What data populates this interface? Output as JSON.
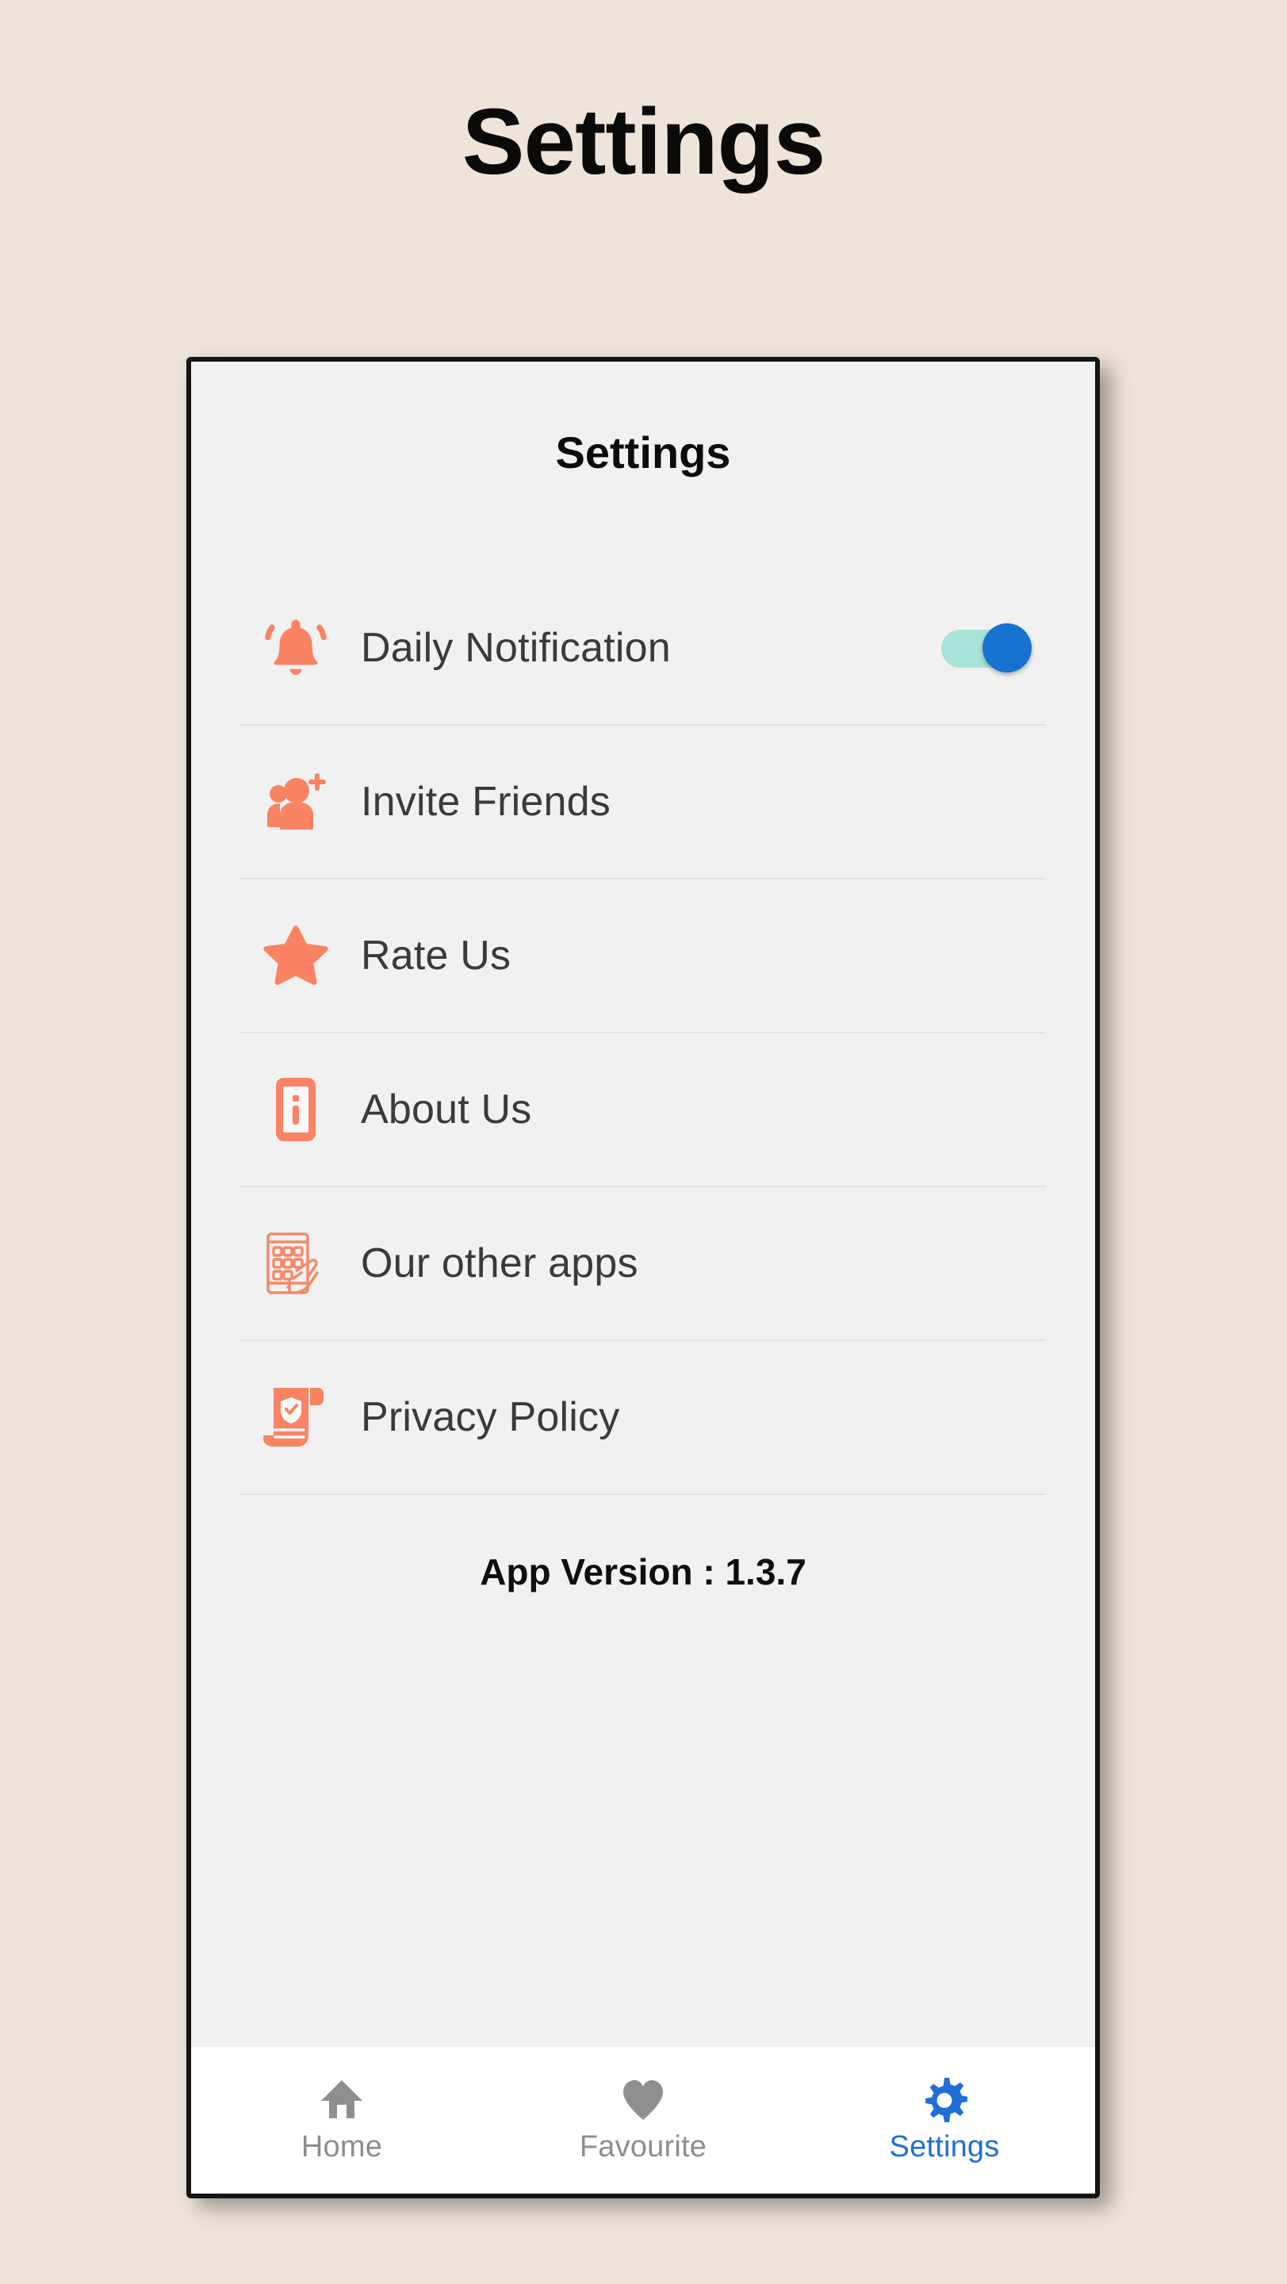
{
  "page": {
    "title": "Settings",
    "background_color": "#efe4d9"
  },
  "phone": {
    "screen_header": "Settings",
    "screen_background": "#f1f1f1",
    "accent_color": "#f98363",
    "toggle_on_track_color": "#a8e3da",
    "toggle_on_thumb_color": "#1773cf",
    "active_nav_color": "#1f6fd6",
    "inactive_nav_color": "#8e8e8e"
  },
  "settings": {
    "rows": [
      {
        "label": "Daily Notification",
        "icon": "bell-icon",
        "control": "toggle",
        "toggle_state": "on"
      },
      {
        "label": "Invite Friends",
        "icon": "invite-friends-icon",
        "control": "none"
      },
      {
        "label": "Rate Us",
        "icon": "star-icon",
        "control": "none"
      },
      {
        "label": "About Us",
        "icon": "about-info-icon",
        "control": "none"
      },
      {
        "label": "Our other apps",
        "icon": "hand-holding-phone-icon",
        "control": "none"
      },
      {
        "label": "Privacy Policy",
        "icon": "privacy-scroll-icon",
        "control": "none"
      }
    ],
    "app_version": "App Version : 1.3.7"
  },
  "bottom_nav": {
    "items": [
      {
        "label": "Home",
        "icon": "home-icon",
        "active": false
      },
      {
        "label": "Favourite",
        "icon": "heart-icon",
        "active": false
      },
      {
        "label": "Settings",
        "icon": "gear-icon",
        "active": true
      }
    ]
  }
}
